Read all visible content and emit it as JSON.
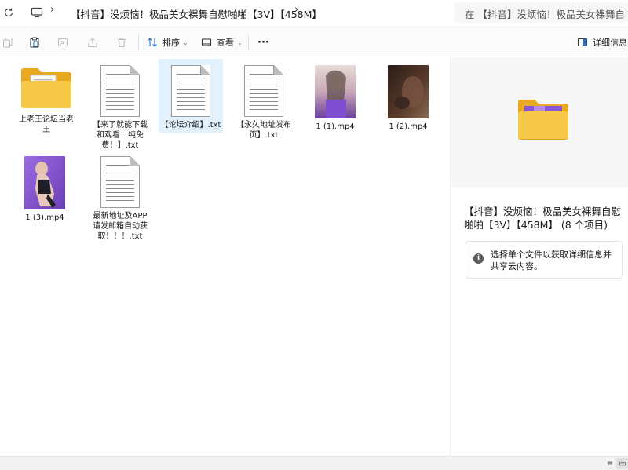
{
  "address": {
    "breadcrumb": "【抖音】没烦恼！极品美女裸舞自慰啪啪【3V】【458M】",
    "search_placeholder": "在 【抖音】没烦恼！极品美女裸舞自"
  },
  "toolbar": {
    "sort_label": "排序",
    "view_label": "查看",
    "more_label": "···",
    "details_label": "详细信息"
  },
  "files": [
    {
      "name": "上老王论坛当老王",
      "type": "folder"
    },
    {
      "name": "【来了就能下载和观看！纯免费！】.txt",
      "type": "txt"
    },
    {
      "name": "【论坛介绍】.txt",
      "type": "txt",
      "selected": true
    },
    {
      "name": "【永久地址发布页】.txt",
      "type": "txt"
    },
    {
      "name": "1 (1).mp4",
      "type": "video"
    },
    {
      "name": "1 (2).mp4",
      "type": "video"
    },
    {
      "name": "1 (3).mp4",
      "type": "video"
    },
    {
      "name": "最新地址及APP请发邮箱自动获取！！！.txt",
      "type": "txt"
    }
  ],
  "details": {
    "title": "【抖音】没烦恼！极品美女裸舞自慰啪啪【3V】【458M】 (8 个项目)",
    "info": "选择单个文件以获取详细信息并共享云内容。"
  },
  "colors": {
    "folder": "#f5c64a",
    "selected": "#e3f1fd",
    "accent": "#1a73c8"
  }
}
